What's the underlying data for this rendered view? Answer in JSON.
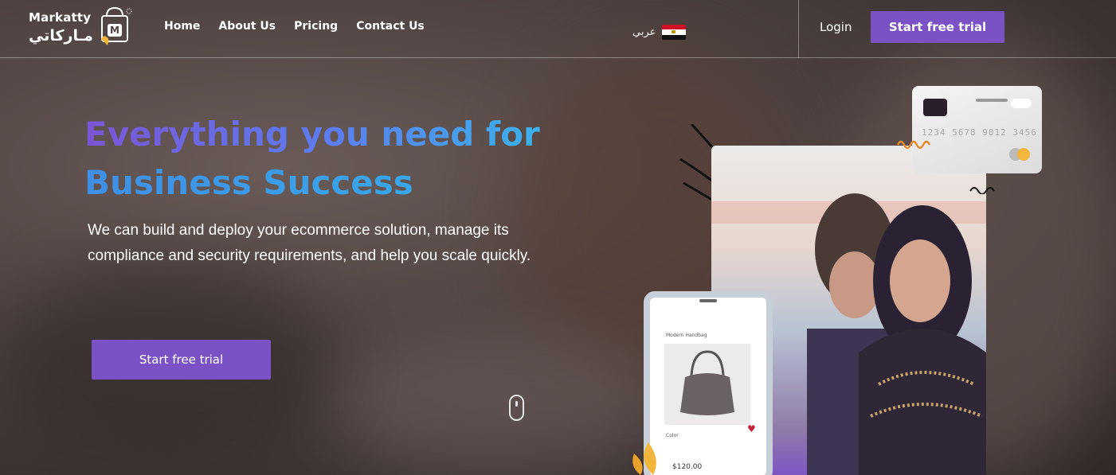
{
  "brand": {
    "name_en": "Markatty",
    "name_ar": "مـاركاتي",
    "logo_letter": "M"
  },
  "nav": {
    "links": [
      "Home",
      "About Us",
      "Pricing",
      "Contact Us"
    ],
    "language_label": "عربي",
    "login_label": "Login",
    "cta_label": "Start free trial"
  },
  "hero": {
    "title_line1": "Everything you need for",
    "title_line2": "Business Success",
    "description": "We can build and deploy your ecommerce solution, manage its compliance and security requirements, and help you scale quickly.",
    "cta_label": "Start free trial"
  },
  "illustration": {
    "card_number": "1234 5678 9012 3456",
    "phone_breadcrumb": "Modern   Handbag",
    "phone_color_label": "Color",
    "phone_price": "$120.00"
  },
  "colors": {
    "accent": "#7b52c6",
    "title_gradient_start": "#7b55d6",
    "title_gradient_end": "#3bb2ea"
  },
  "icons": [
    "shopping-bag-logo-icon",
    "egypt-flag-icon",
    "scroll-mouse-icon",
    "heart-icon",
    "handbag-icon"
  ]
}
